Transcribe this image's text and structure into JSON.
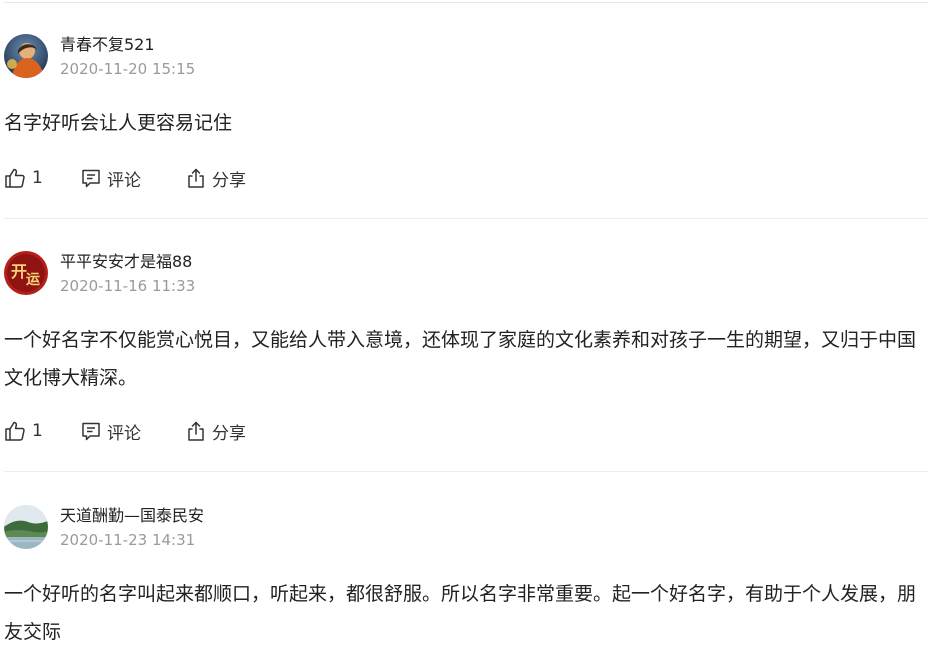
{
  "comments": [
    {
      "username": "青春不复521",
      "timestamp": "2020-11-20 15:15",
      "content": "名字好听会让人更容易记住",
      "likes": "1",
      "comment_label": "评论",
      "share_label": "分享"
    },
    {
      "username": "平平安安才是福88",
      "timestamp": "2020-11-16 11:33",
      "content": "一个好名字不仅能赏心悦目，又能给人带入意境，还体现了家庭的文化素养和对孩子一生的期望，又归于中国文化博大精深。",
      "likes": "1",
      "comment_label": "评论",
      "share_label": "分享"
    },
    {
      "username": "天道酬勤—国泰民安",
      "timestamp": "2020-11-23 14:31",
      "content": "一个好听的名字叫起来都顺口，听起来，都很舒服。所以名字非常重要。起一个好名字，有助于个人发展，朋友交际"
    }
  ],
  "icons": {
    "like": "thumbs-up-icon",
    "comment": "comment-icon",
    "share": "share-icon"
  },
  "colors": {
    "text": "#222222",
    "meta": "#9a9a9a",
    "divider": "#ececec"
  }
}
